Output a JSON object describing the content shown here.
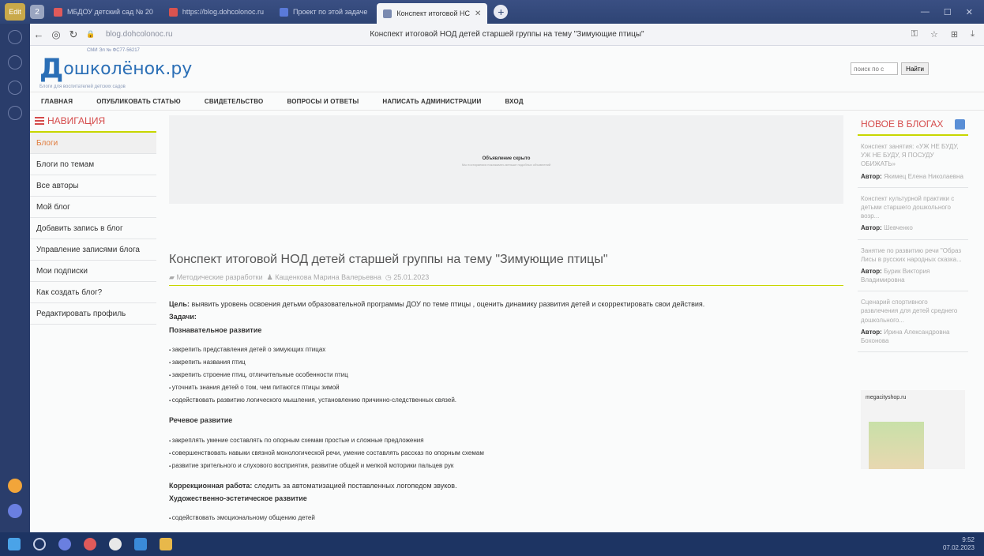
{
  "browser": {
    "tabs": [
      {
        "label": "МБДОУ детский сад № 20",
        "color": "#e05a5a"
      },
      {
        "label": "https://blog.dohcolonoc.ru",
        "color": "#d9534f"
      },
      {
        "label": "Проект по этой задаче",
        "color": "#5a7ad9"
      },
      {
        "label": "Конспект итоговой НС",
        "color": "#7a8ab0",
        "active": true
      }
    ],
    "url": "blog.dohcolonoc.ru",
    "page_title": "Конспект итоговой НОД детей старшей группы на тему \"Зимующие птицы\""
  },
  "site": {
    "smi": "СМИ Эл № ФС77-56217",
    "logo_d": "Д",
    "logo_text": "ошколёнок.ру",
    "logo_sub": "Блоги для воспитателей детских садов",
    "search_placeholder": "поиск по с",
    "search_button": "Найти"
  },
  "menu": [
    "ГЛАВНАЯ",
    "ОПУБЛИКОВАТЬ СТАТЬЮ",
    "СВИДЕТЕЛЬСТВО",
    "ВОПРОСЫ И ОТВЕТЫ",
    "НАПИСАТЬ АДМИНИСТРАЦИИ",
    "ВХОД"
  ],
  "navigation": {
    "title": "НАВИГАЦИЯ",
    "items": [
      "Блоги",
      "Блоги по темам",
      "Все авторы",
      "Мой блог",
      "Добавить запись в блог",
      "Управление записями блога",
      "Мои подписки",
      "Как создать блог?",
      "Редактировать профиль"
    ]
  },
  "ad": {
    "hidden_text": "Объявление скрыто",
    "hidden_sub": "Мы постараемся показывать меньше подобных объявлений"
  },
  "article": {
    "title": "Конспект итоговой НОД детей старшей группы на тему \"Зимующие птицы\"",
    "category": "Методические разработки",
    "author": "Кащенкова Марина Валерьевна",
    "date": "25.01.2023",
    "goal_label": "Цель:",
    "goal_text": " выявить уровень освоения детьми образовательной программы ДОУ по теме птицы , оценить динамику развития детей и скорректировать свои действия.",
    "tasks_label": "Задачи",
    "section1": "Познавательное развитие",
    "section1_items": [
      "закрепить представления детей о зимующих птицах",
      "закрепить названия птиц",
      "закрепить строение птиц, отличительные особенности птиц",
      "уточнить знания детей о том, чем питаются птицы зимой",
      "содействовать развитию логического мышления, установлению причинно-следственных связей."
    ],
    "section2": "Речевое развитие",
    "section2_items": [
      "закреплять умение составлять по опорным схемам простые и сложные предложения",
      "совершенствовать навыки связной монологической речи, умение составлять рассказ по опорным схемам",
      "развитие зрительного и слухового восприятия, развитие общей и мелкой моторики пальцев рук"
    ],
    "correction_label": "Коррекционная работа:",
    "correction_text": " следить за автоматизацией поставленных логопедом звуков.",
    "section3": "Художественно-эстетическое развитие",
    "section3_items": [
      "содействовать эмоциональному общению детей"
    ]
  },
  "right": {
    "title": "НОВОЕ В БЛОГАХ",
    "author_label": "Автор:",
    "items": [
      {
        "title": "Конспект занятия: «УЖ НЕ БУДУ, УЖ НЕ БУДУ, Я ПОСУДУ ОБИЖАТЬ»",
        "author": "Якимец Елена Николаевна"
      },
      {
        "title": "Конспект культурной практики с детьми старшего дошкольного возр...",
        "author": "Шевченко"
      },
      {
        "title": "Занятие по развитию речи \"Образ Лисы в русских народных сказка...",
        "author": "Бурик Виктория Владимировна"
      },
      {
        "title": "Сценарий спортивного развлечения для детей среднего дошкольного...",
        "author": "Ирина Александровна Бохонова"
      }
    ],
    "ad_label": "megacityshop.ru"
  },
  "taskbar": {
    "time": "9:52",
    "date": "07.02.2023"
  }
}
